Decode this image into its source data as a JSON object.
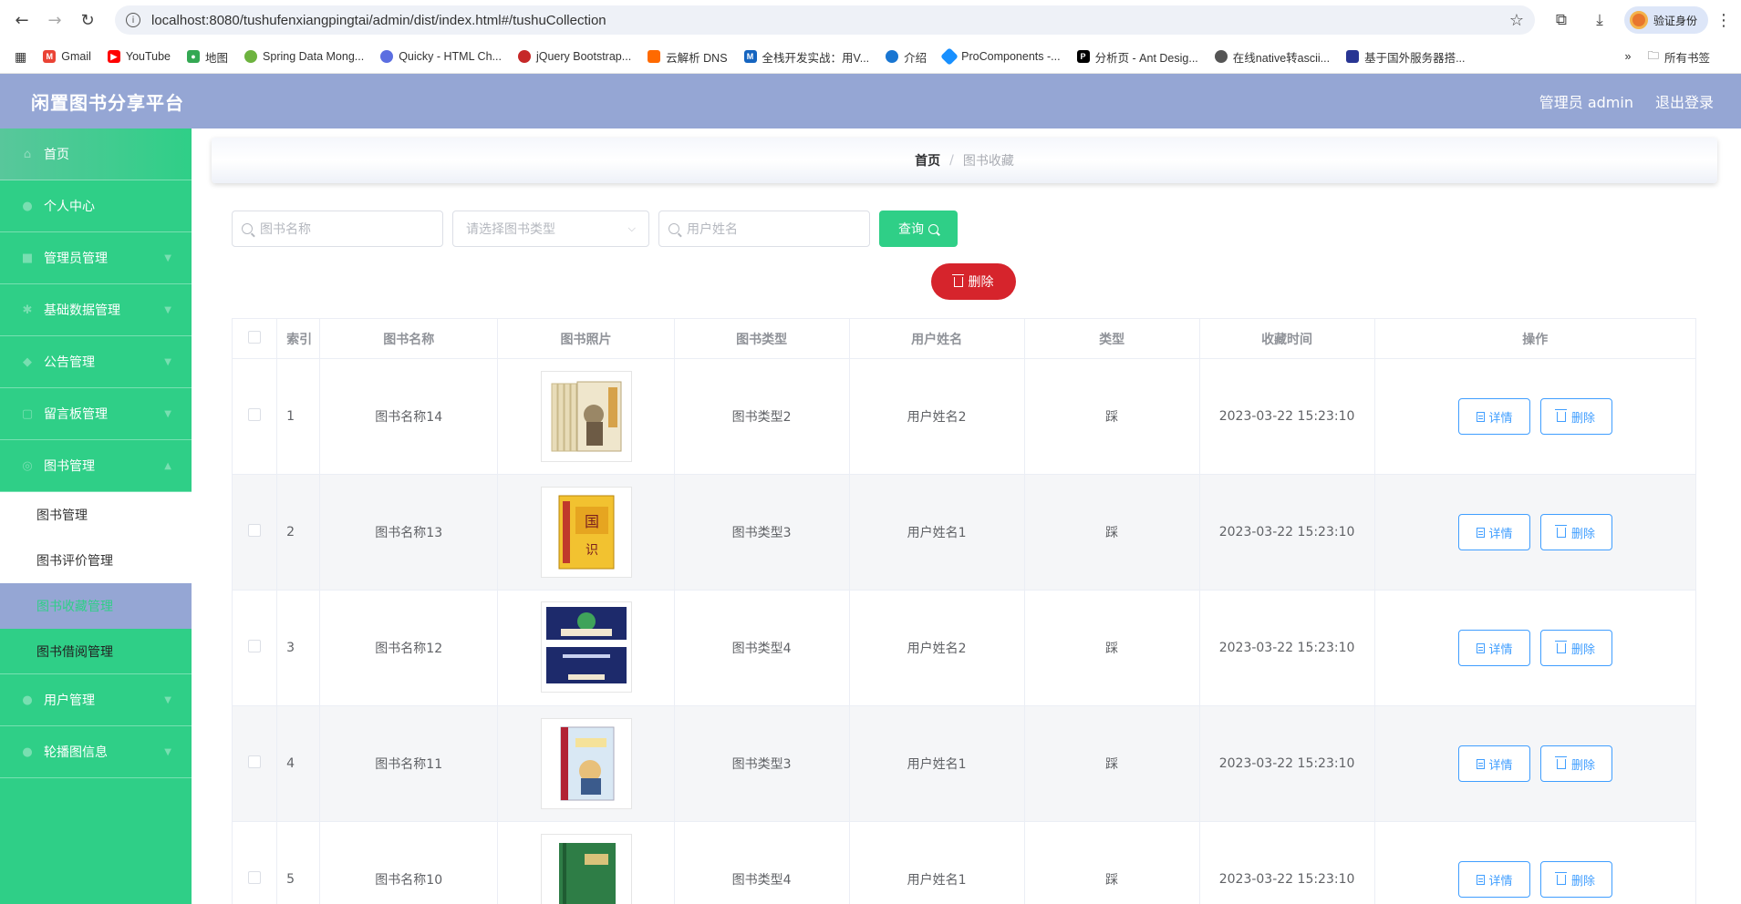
{
  "browser": {
    "url": "localhost:8080/tushufenxiangpingtai/admin/dist/index.html#/tushuCollection",
    "profile_label": "验证身份",
    "bookmarks": [
      {
        "label": "Gmail",
        "color": "#ea4335"
      },
      {
        "label": "YouTube",
        "color": "#ff0000"
      },
      {
        "label": "地图",
        "color": "#34a853"
      },
      {
        "label": "Spring Data Mong...",
        "color": "#6db33f"
      },
      {
        "label": "Quicky - HTML Ch...",
        "color": "#5b6ee1"
      },
      {
        "label": "jQuery Bootstrap...",
        "color": "#c62828"
      },
      {
        "label": "云解析 DNS",
        "color": "#ff6a00"
      },
      {
        "label": "全栈开发实战：用V...",
        "color": "#1565c0"
      },
      {
        "label": "介绍",
        "color": "#1976d2"
      },
      {
        "label": "ProComponents -...",
        "color": "#1890ff"
      },
      {
        "label": "分析页 - Ant Desig...",
        "color": "#000000"
      },
      {
        "label": "在线native转ascii...",
        "color": "#555555"
      },
      {
        "label": "基于国外服务器搭...",
        "color": "#283593"
      }
    ],
    "all_bookmarks": "所有书签"
  },
  "header": {
    "title": "闲置图书分享平台",
    "user": "管理员 admin",
    "logout": "退出登录"
  },
  "sidebar": {
    "items": [
      {
        "label": "首页"
      },
      {
        "label": "个人中心"
      },
      {
        "label": "管理员管理"
      },
      {
        "label": "基础数据管理"
      },
      {
        "label": "公告管理"
      },
      {
        "label": "留言板管理"
      },
      {
        "label": "图书管理"
      }
    ],
    "subitems": [
      {
        "label": "图书管理"
      },
      {
        "label": "图书评价管理"
      },
      {
        "label": "图书收藏管理"
      },
      {
        "label": "图书借阅管理"
      }
    ],
    "bottom_items": [
      {
        "label": "用户管理"
      },
      {
        "label": "轮播图信息"
      }
    ]
  },
  "breadcrumb": {
    "home": "首页",
    "separator": "/",
    "current": "图书收藏"
  },
  "search": {
    "book_name_placeholder": "图书名称",
    "type_placeholder": "请选择图书类型",
    "user_placeholder": "用户姓名",
    "query_label": "查询",
    "delete_label": "删除"
  },
  "table": {
    "headers": [
      "索引",
      "图书名称",
      "图书照片",
      "图书类型",
      "用户姓名",
      "类型",
      "收藏时间",
      "操作"
    ],
    "detail_label": "详情",
    "delete_label": "删除",
    "rows": [
      {
        "index": "1",
        "name": "图书名称14",
        "type": "图书类型2",
        "user": "用户姓名2",
        "kind": "踩",
        "time": "2023-03-22 15:23:10"
      },
      {
        "index": "2",
        "name": "图书名称13",
        "type": "图书类型3",
        "user": "用户姓名1",
        "kind": "踩",
        "time": "2023-03-22 15:23:10"
      },
      {
        "index": "3",
        "name": "图书名称12",
        "type": "图书类型4",
        "user": "用户姓名2",
        "kind": "踩",
        "time": "2023-03-22 15:23:10"
      },
      {
        "index": "4",
        "name": "图书名称11",
        "type": "图书类型3",
        "user": "用户姓名1",
        "kind": "踩",
        "time": "2023-03-22 15:23:10"
      },
      {
        "index": "5",
        "name": "图书名称10",
        "type": "图书类型4",
        "user": "用户姓名1",
        "kind": "踩",
        "time": "2023-03-22 15:23:10"
      }
    ]
  }
}
